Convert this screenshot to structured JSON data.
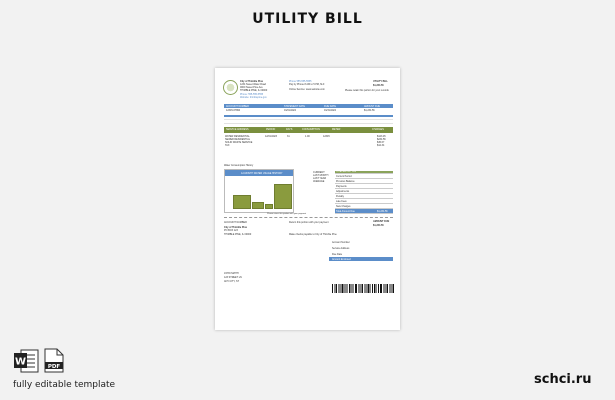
{
  "header": {
    "title": "UTILITY BILL"
  },
  "document": {
    "issuer": {
      "name": "City of Thimble Pine",
      "lines": [
        "1234 Sweet Water Road",
        "0000 Sweet Pine Ave",
        "THIMBLE PINE, IL 00000"
      ],
      "phone": "Phone: 555-555-5555",
      "website": "Website: thimblepine.gov"
    },
    "contact": {
      "lines": [
        "Phone 555-555-5555",
        "Pay by Phone 8 AM to 5 PM, M-F",
        "Online Service: www.website.com"
      ]
    },
    "due_box": {
      "label": "UTILITY BILL",
      "amount": "$1,234.56",
      "note": "Please retain this portion for your records"
    },
    "account_bar": [
      "ACCOUNT NUMBER",
      "STATEMENT DATE",
      "DUE DATE",
      "AMOUNT DUE"
    ],
    "account_values": [
      "12345-67890",
      "01/01/2024",
      "01/31/2024",
      "$1,234.56"
    ],
    "service_bar": [
      "SERVICE ADDRESS",
      "PERIOD",
      "DAYS",
      "CONSUMPTION",
      "METER",
      "CHARGES"
    ],
    "service_rows": [
      [
        "WATER RESIDENTIAL",
        "12/01/2023",
        "31",
        "1.00",
        "12345",
        "$123.45"
      ],
      [
        "SEWER RESIDENTIAL",
        "",
        "",
        "",
        "",
        "$234.56"
      ],
      [
        "SOLID WASTE SERVICE",
        "",
        "",
        "",
        "",
        "$45.67"
      ],
      [
        "TAX",
        "",
        "",
        "",
        "",
        "$12.34"
      ]
    ],
    "chart": {
      "caption": "Water Consumption History",
      "header": "12-MONTH WATER USAGE HISTORY"
    },
    "legend": [
      "CURRENT",
      "LAST MONTH",
      "LAST YEAR",
      "AVERAGE"
    ],
    "summary": {
      "header": "TOTAL AMOUNT DUE",
      "rows": [
        "Current Period",
        "Previous Balance",
        "Payments",
        "Adjustments",
        "Penalty",
        "Late Fees",
        "New Charges"
      ],
      "total_label": "Total Amount Due",
      "total": "$1,234.56"
    },
    "cut_line": "Please return this portion with your payment",
    "stub": {
      "left": [
        "ACCOUNT NUMBER",
        "City of Thimble Pine",
        "PO BOX 123",
        "THIMBLE PINE, IL 00000"
      ],
      "middle": [
        "Return this portion with your payment",
        "Make checks payable to City of Thimble Pine"
      ],
      "amount_label": "AMOUNT DUE",
      "amount": "$1,234.56",
      "rows": [
        "Account Number",
        "Service Address",
        "Due Date",
        "Amount Enclosed"
      ],
      "recipient": [
        "JOHN SMITH",
        "123 STREET LN",
        "ANY CITY, ST"
      ]
    }
  },
  "footer": {
    "word_icon": "word-doc-icon",
    "pdf_icon": "pdf-doc-icon",
    "caption": "fully editable template",
    "brand": "schci.ru"
  },
  "colors": {
    "accent_blue": "#5b8dc9",
    "accent_green": "#7a8f3e",
    "bar_green": "#8a9b3e"
  }
}
